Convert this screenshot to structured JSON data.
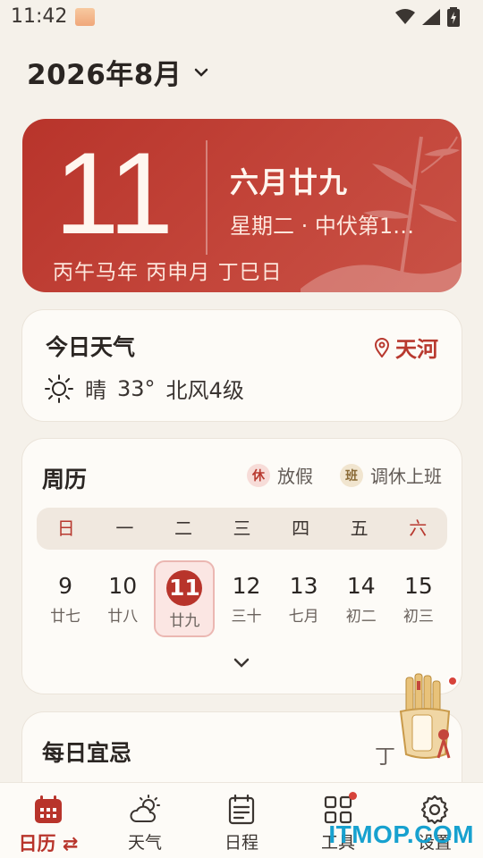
{
  "status_bar": {
    "time": "11:42"
  },
  "header": {
    "month_title": "2026年8月"
  },
  "hero": {
    "day": "11",
    "lunar_date": "六月廿九",
    "weekday_line": "星期二 · 中伏第1…",
    "ganzhi_line": "丙午马年 丙申月 丁巳日"
  },
  "weather": {
    "title": "今日天气",
    "location": "天河",
    "condition": "晴",
    "temperature": "33°",
    "wind": "北风",
    "wind_level": "4级"
  },
  "week_calendar": {
    "title": "周历",
    "legend_rest_badge": "休",
    "legend_rest_label": "放假",
    "legend_work_badge": "班",
    "legend_work_label": "调休上班",
    "weekdays": [
      "日",
      "一",
      "二",
      "三",
      "四",
      "五",
      "六"
    ],
    "days": [
      {
        "num": "9",
        "lunar": "廿七"
      },
      {
        "num": "10",
        "lunar": "廿八"
      },
      {
        "num": "11",
        "lunar": "廿九"
      },
      {
        "num": "12",
        "lunar": "三十"
      },
      {
        "num": "13",
        "lunar": "七月"
      },
      {
        "num": "14",
        "lunar": "初二"
      },
      {
        "num": "15",
        "lunar": "初三"
      }
    ]
  },
  "yiji": {
    "title": "每日宜忌",
    "right_text": "丁"
  },
  "fortune_widget": {
    "label": "每日一签"
  },
  "bottom_nav": {
    "items": [
      {
        "label": "日历 ⇄"
      },
      {
        "label": "天气"
      },
      {
        "label": "日程"
      },
      {
        "label": "工具"
      },
      {
        "label": "设置"
      }
    ]
  },
  "watermark": "ITMOP.COM",
  "colors": {
    "accent": "#b8342b",
    "background": "#f5f1ea",
    "card": "#fdfbf7",
    "watermark": "#17a1cf"
  }
}
